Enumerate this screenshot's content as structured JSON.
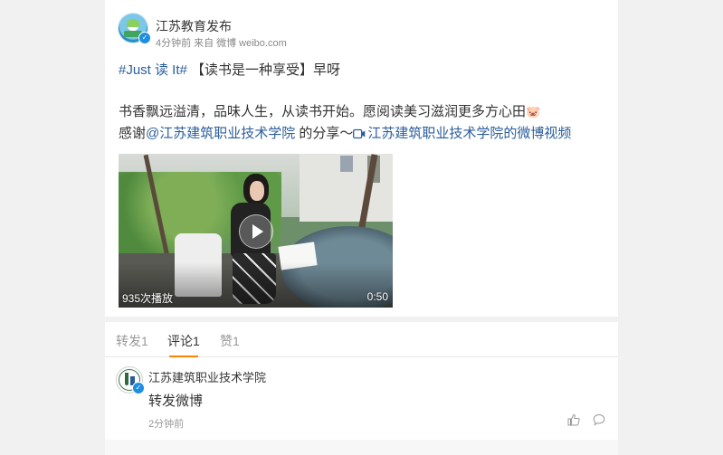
{
  "post": {
    "author": "江苏教育发布",
    "verified_badge": "✓",
    "time": "4分钟前",
    "source_prefix": "来自",
    "source": "微博 weibo.com",
    "topic": "#Just 读 It#",
    "headline": "【读书是一种享受】早呀",
    "body_line1": "书香飘远溢清，品味人生，从读书开始。愿阅读美习滋润更多方心田",
    "emoji_pig": "🐷",
    "thanks_prefix": "感谢",
    "mention": "@江苏建筑职业技术学院",
    "share_text": " 的分享～",
    "video_link": "江苏建筑职业技术学院的微博视频",
    "video": {
      "views": "935次播放",
      "duration": "0:50"
    }
  },
  "tabs": [
    {
      "label": "转发1",
      "active": false
    },
    {
      "label": "评论1",
      "active": true
    },
    {
      "label": "赞1",
      "active": false
    }
  ],
  "comment": {
    "author": "江苏建筑职业技术学院",
    "text": "转发微博",
    "time": "2分钟前",
    "like_icon": "thumbs-up-icon",
    "reply_icon": "comment-bubble-icon"
  },
  "colors": {
    "link": "#2b5d9b",
    "accent": "#ff8200",
    "verified": "#1f8de0"
  }
}
